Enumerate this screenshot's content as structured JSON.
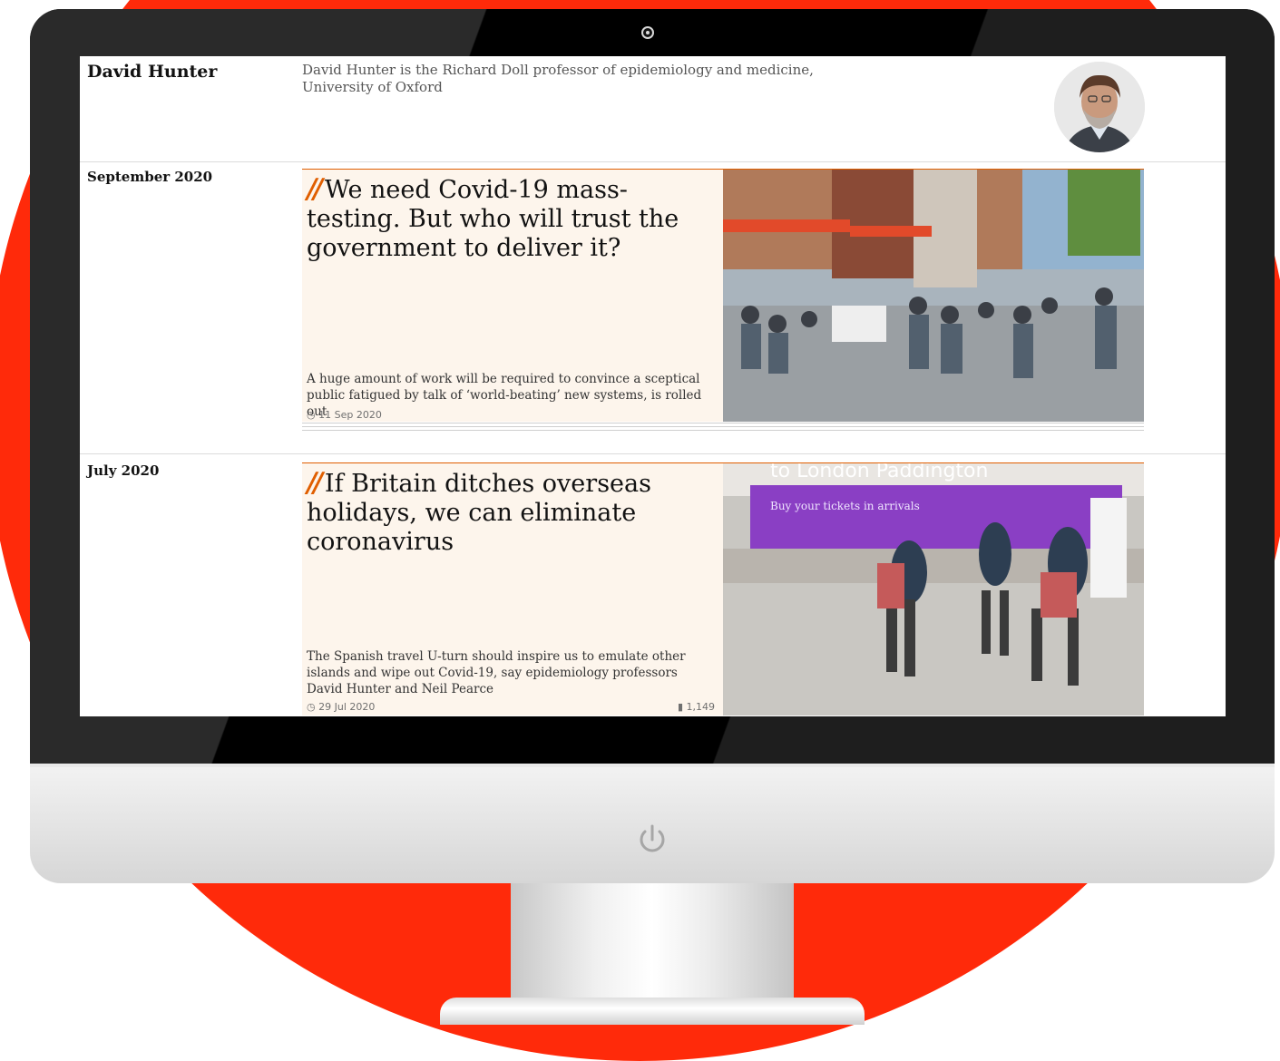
{
  "author": {
    "name": "David Hunter",
    "bio": "David Hunter is the Richard Doll professor of epidemiology and medicine, University of Oxford"
  },
  "sections": [
    {
      "month": "September 2020",
      "headline": "We need Covid-19 mass-testing. But who will trust the government to deliver it?",
      "standfirst": "A huge amount of work will be required to convince a sceptical public fatigued by talk of ‘world-beating’ new systems, is rolled out",
      "date": "11 Sep 2020"
    },
    {
      "month": "July 2020",
      "headline": "If Britain ditches overseas holidays, we can eliminate coronavirus",
      "standfirst": "The Spanish travel U-turn should inspire us to emulate other islands and wipe out Covid-19, say epidemiology professors David Hunter and Neil Pearce",
      "date": "29 Jul 2020",
      "comments": "1,149",
      "image_sign": {
        "title": "to London Paddington",
        "subtitle": "Buy your tickets in arrivals"
      }
    }
  ],
  "colors": {
    "accent": "#e05e00",
    "background_circle": "#ff2a0a",
    "card": "#fdf5ec"
  },
  "icons": [
    "clock-icon",
    "comment-icon",
    "quote-icon",
    "power-icon",
    "camera-icon"
  ]
}
